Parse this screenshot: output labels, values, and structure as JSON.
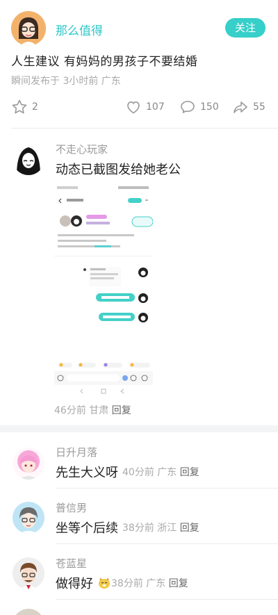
{
  "post": {
    "author": "那么值得",
    "follow_label": "关注",
    "title": "人生建议  有妈妈的男孩子不要结婚",
    "meta": "瞬间发布于 3小时前 广东",
    "stats": {
      "favorites": "2",
      "likes": "107",
      "comments": "150",
      "shares": "55"
    }
  },
  "comments": [
    {
      "name": "不走心玩家",
      "text": "动态已截图发给她老公",
      "time": "46分前",
      "location": "甘肃",
      "reply": "回复"
    },
    {
      "name": "日升月落",
      "text": "先生大义呀",
      "time": "40分前",
      "location": "广东",
      "reply": "回复"
    },
    {
      "name": "普信男",
      "text": "坐等个后续",
      "time": "38分前",
      "location": "浙江",
      "reply": "回复"
    },
    {
      "name": "苍蓝星",
      "text": "做得好",
      "time": "38分前",
      "location": "广东",
      "reply": "回复"
    }
  ],
  "screenshot": {
    "status": "中国移动 10:15",
    "title": "瞬间个二",
    "chat_1": "来个关注收藏",
    "chat_2": "我也是这么想的"
  },
  "colors": {
    "accent": "#36cfc9",
    "accent_text": "#2ec7c7"
  }
}
